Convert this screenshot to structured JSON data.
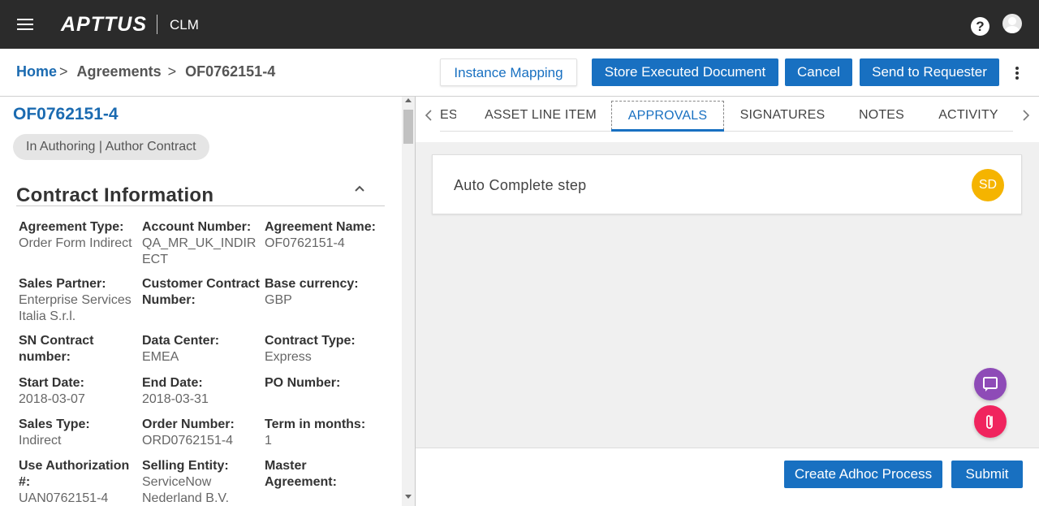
{
  "topbar": {
    "brand": "APTTUS",
    "app": "CLM",
    "help_symbol": "?",
    "icons": [
      "menu-icon",
      "help-icon",
      "user-avatar-icon"
    ]
  },
  "breadcrumb": {
    "home": "Home",
    "separator": ">",
    "agreements": "Agreements",
    "record": "OF0762151-4"
  },
  "actions": {
    "instance_mapping": "Instance Mapping",
    "store_executed": "Store Executed Document",
    "cancel": "Cancel",
    "send_to_requester": "Send to Requester"
  },
  "record": {
    "title": "OF0762151-4",
    "status": "In Authoring | Author Contract"
  },
  "contract_info": {
    "title": "Contract Information",
    "fields": [
      {
        "label": "Agreement Type:",
        "value": "Order Form Indirect"
      },
      {
        "label": "Account Number:",
        "value": "QA_MR_UK_INDIRECT"
      },
      {
        "label": "Agreement Name:",
        "value": "OF0762151-4"
      },
      {
        "label": "Sales Partner:",
        "value": "Enterprise Services Italia S.r.l."
      },
      {
        "label": "Customer Contract Number:",
        "value": ""
      },
      {
        "label": "Base currency:",
        "value": "GBP"
      },
      {
        "label": "SN Contract number:",
        "value": ""
      },
      {
        "label": "Data Center:",
        "value": "EMEA"
      },
      {
        "label": "Contract Type:",
        "value": "Express"
      },
      {
        "label": "Start Date:",
        "value": "2018-03-07"
      },
      {
        "label": "End Date:",
        "value": "2018-03-31"
      },
      {
        "label": "PO Number:",
        "value": ""
      },
      {
        "label": "Sales Type:",
        "value": "Indirect"
      },
      {
        "label": "Order Number:",
        "value": "ORD0762151-4"
      },
      {
        "label": "Term in months:",
        "value": "1"
      },
      {
        "label": "Use Authorization #:",
        "value": "UAN0762151-4"
      },
      {
        "label": "Selling Entity:",
        "value": "ServiceNow Nederland B.V."
      },
      {
        "label": "Master Agreement:",
        "value": ""
      }
    ]
  },
  "tabs": [
    {
      "label": "ES"
    },
    {
      "label": "ASSET LINE ITEM"
    },
    {
      "label": "APPROVALS",
      "active": true
    },
    {
      "label": "SIGNATURES"
    },
    {
      "label": "NOTES"
    },
    {
      "label": "ACTIVITY"
    }
  ],
  "approvals": {
    "step_label": "Auto Complete step",
    "assignee_initials": "SD"
  },
  "footer": {
    "create_adhoc": "Create Adhoc Process",
    "submit": "Submit"
  },
  "colors": {
    "primary": "#1870c1",
    "topbar": "#2b2b2b",
    "badge": "#f5b400",
    "chat_fab": "#8e4bb7",
    "attach_fab": "#f0245e"
  }
}
